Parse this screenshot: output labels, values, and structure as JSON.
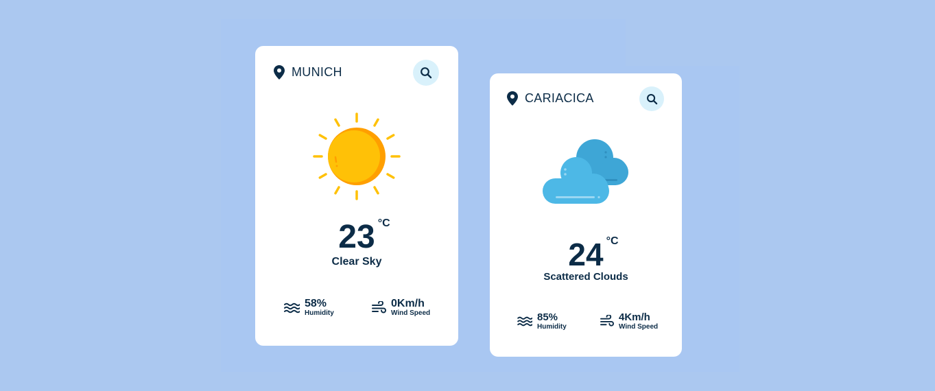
{
  "colors": {
    "background": "#abc8f0",
    "card": "#ffffff",
    "text": "#0c2c47",
    "search_button": "#d9f1fb",
    "sun": "#ffc107",
    "sun_shade": "#ff9f00",
    "cloud_front": "#4db8e6",
    "cloud_back": "#3ea6d6"
  },
  "cards": [
    {
      "city": "MUNICH",
      "icon": "sun-icon",
      "temperature": "23",
      "unit": "°C",
      "description": "Clear Sky",
      "humidity": {
        "value": "58%",
        "label": "Humidity",
        "icon": "humidity-waves-icon"
      },
      "wind": {
        "value": "0Km/h",
        "label": "Wind Speed",
        "icon": "wind-icon"
      }
    },
    {
      "city": "CARIACICA",
      "icon": "clouds-icon",
      "temperature": "24",
      "unit": "°C",
      "description": "Scattered Clouds",
      "humidity": {
        "value": "85%",
        "label": "Humidity",
        "icon": "humidity-waves-icon"
      },
      "wind": {
        "value": "4Km/h",
        "label": "Wind Speed",
        "icon": "wind-icon"
      }
    }
  ]
}
